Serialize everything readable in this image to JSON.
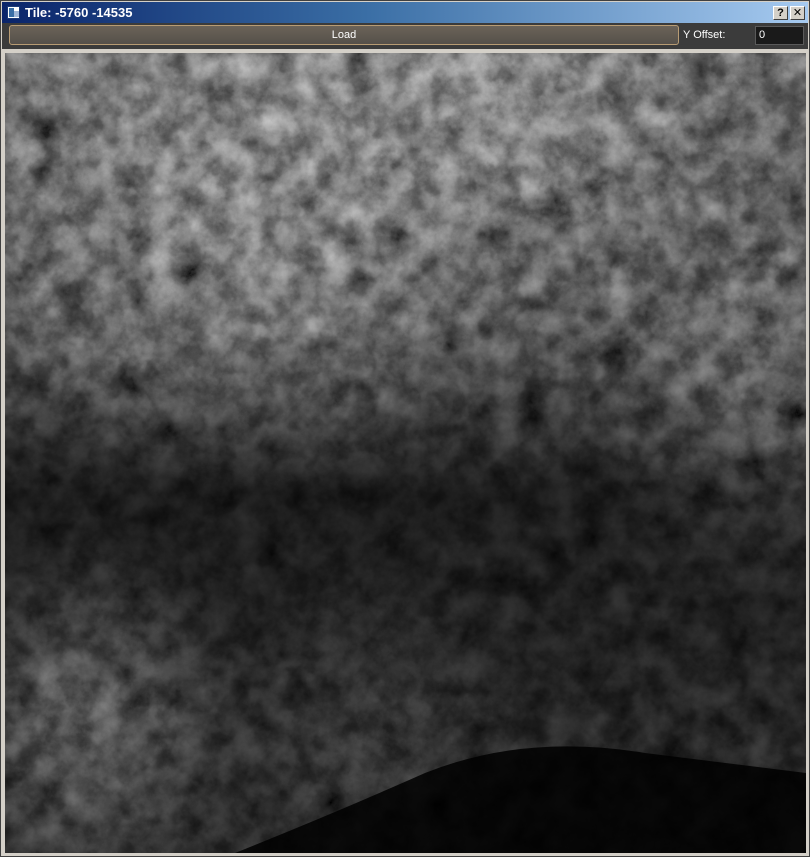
{
  "window": {
    "title": "Tile: -5760 -14535",
    "help_glyph": "?",
    "close_glyph": "✕"
  },
  "toolbar": {
    "load_label": "Load",
    "y_offset_label": "Y Offset:",
    "y_offset_value": "0"
  },
  "viewport": {
    "content": "grayscale heightmap terrain render"
  },
  "colors": {
    "toolbar_bg": "#3b3b3b",
    "button_border": "#b89c74",
    "titlebar_start": "#0a246a",
    "titlebar_end": "#a6caf0"
  }
}
